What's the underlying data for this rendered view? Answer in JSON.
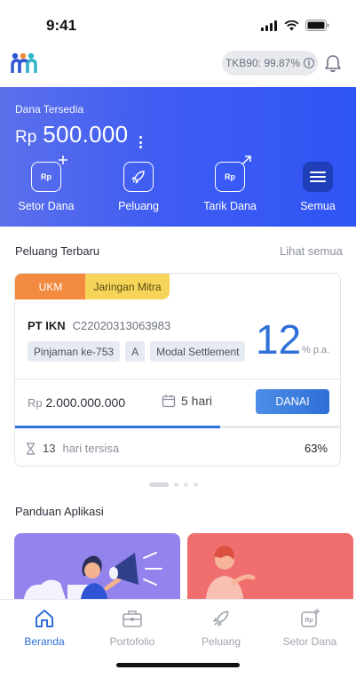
{
  "status_bar": {
    "time": "9:41"
  },
  "header": {
    "tkb_label": "TKB90: 99.87%",
    "info_glyph": "i"
  },
  "funds": {
    "label": "Dana Tersedia",
    "currency": "Rp",
    "amount": "500.000",
    "actions": [
      {
        "label": "Setor Dana",
        "icon": "deposit-icon",
        "icon_text": "Rp"
      },
      {
        "label": "Peluang",
        "icon": "rocket-icon"
      },
      {
        "label": "Tarik Dana",
        "icon": "withdraw-icon",
        "icon_text": "Rp"
      },
      {
        "label": "Semua",
        "icon": "menu-icon"
      }
    ]
  },
  "opportunities": {
    "title": "Peluang Terbaru",
    "see_all": "Lihat semua",
    "card": {
      "tags": [
        "UKM",
        "Jaringan Mitra"
      ],
      "company": "PT IKN",
      "code": "C22020313063983",
      "chips": [
        "Pinjaman ke-753",
        "A",
        "Modal Settlement"
      ],
      "rate": "12",
      "rate_unit": "% p.a.",
      "currency": "Rp",
      "amount": "2.000.000.000",
      "duration": "5 hari",
      "cta": "DANAI",
      "remaining_days": "13",
      "remaining_text": "hari tersisa",
      "progress_percent": 63,
      "progress_label": "63%"
    }
  },
  "guide": {
    "title": "Panduan Aplikasi"
  },
  "bottom_nav": {
    "items": [
      {
        "label": "Beranda",
        "icon": "home-icon",
        "active": true
      },
      {
        "label": "Portofolio",
        "icon": "briefcase-icon",
        "active": false
      },
      {
        "label": "Peluang",
        "icon": "rocket-icon",
        "active": false
      },
      {
        "label": "Setor Dana",
        "icon": "deposit-icon",
        "icon_text": "Rp",
        "active": false
      }
    ]
  },
  "colors": {
    "primary": "#2f6fd8",
    "panel": "#3f5cf3",
    "ukm": "#f28a3f",
    "mitra": "#f6d45a"
  }
}
